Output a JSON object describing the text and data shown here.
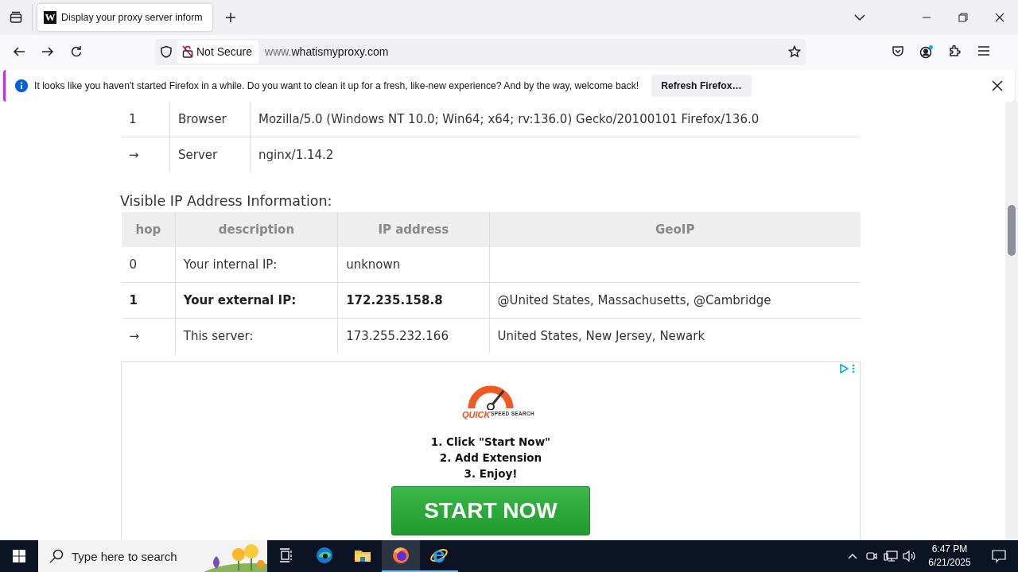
{
  "tab": {
    "favicon": "W",
    "title": "Display your proxy server inform",
    "selected": true
  },
  "toolbar": {
    "security_label": "Not Secure",
    "url_prefix": "www.",
    "url_domain": "whatismyproxy.com"
  },
  "notification": {
    "message": "It looks like you haven't started Firefox in a while. Do you want to clean it up for a fresh, like-new experience? And by the way, welcome back!",
    "button": "Refresh Firefox…"
  },
  "headers_table": {
    "rows": [
      {
        "hop": "1",
        "name": "Browser",
        "value": "Mozilla/5.0 (Windows NT 10.0; Win64; x64; rv:136.0) Gecko/20100101 Firefox/136.0"
      },
      {
        "hop": "→",
        "name": "Server",
        "value": "nginx/1.14.2"
      }
    ]
  },
  "ip_section": {
    "heading": "Visible IP Address Information:",
    "columns": [
      "hop",
      "description",
      "IP address",
      "GeoIP"
    ],
    "rows": [
      {
        "hop": "0",
        "description": "Your internal IP:",
        "ip": "unknown",
        "emphasized": false
      },
      {
        "hop": "1",
        "description": "Your external IP:",
        "ip": "172.235.158.8",
        "geoip": "@United States, Massachusetts, @Cambridge",
        "emphasized": true
      },
      {
        "hop": "→",
        "description": "This server:",
        "ip": "173.255.232.166",
        "geoip": "United States, New Jersey, Newark",
        "emphasized": false
      }
    ]
  },
  "ad": {
    "logo_top": "QUICK",
    "logo_bottom": "SPEED SEARCH",
    "steps": [
      "1. Click \"Start Now\"",
      "2. Add Extension",
      "3. Enjoy!"
    ],
    "button": "START NOW"
  },
  "taskbar": {
    "search_placeholder": "Type here to search",
    "apps": [
      {
        "kind": "edge",
        "active": false,
        "running": false
      },
      {
        "kind": "explorer",
        "active": false,
        "running": false
      },
      {
        "kind": "firefox",
        "active": true,
        "running": true
      },
      {
        "kind": "ie",
        "active": false,
        "running": true
      }
    ],
    "time": "6:47 PM",
    "date": "6/21/2025"
  }
}
